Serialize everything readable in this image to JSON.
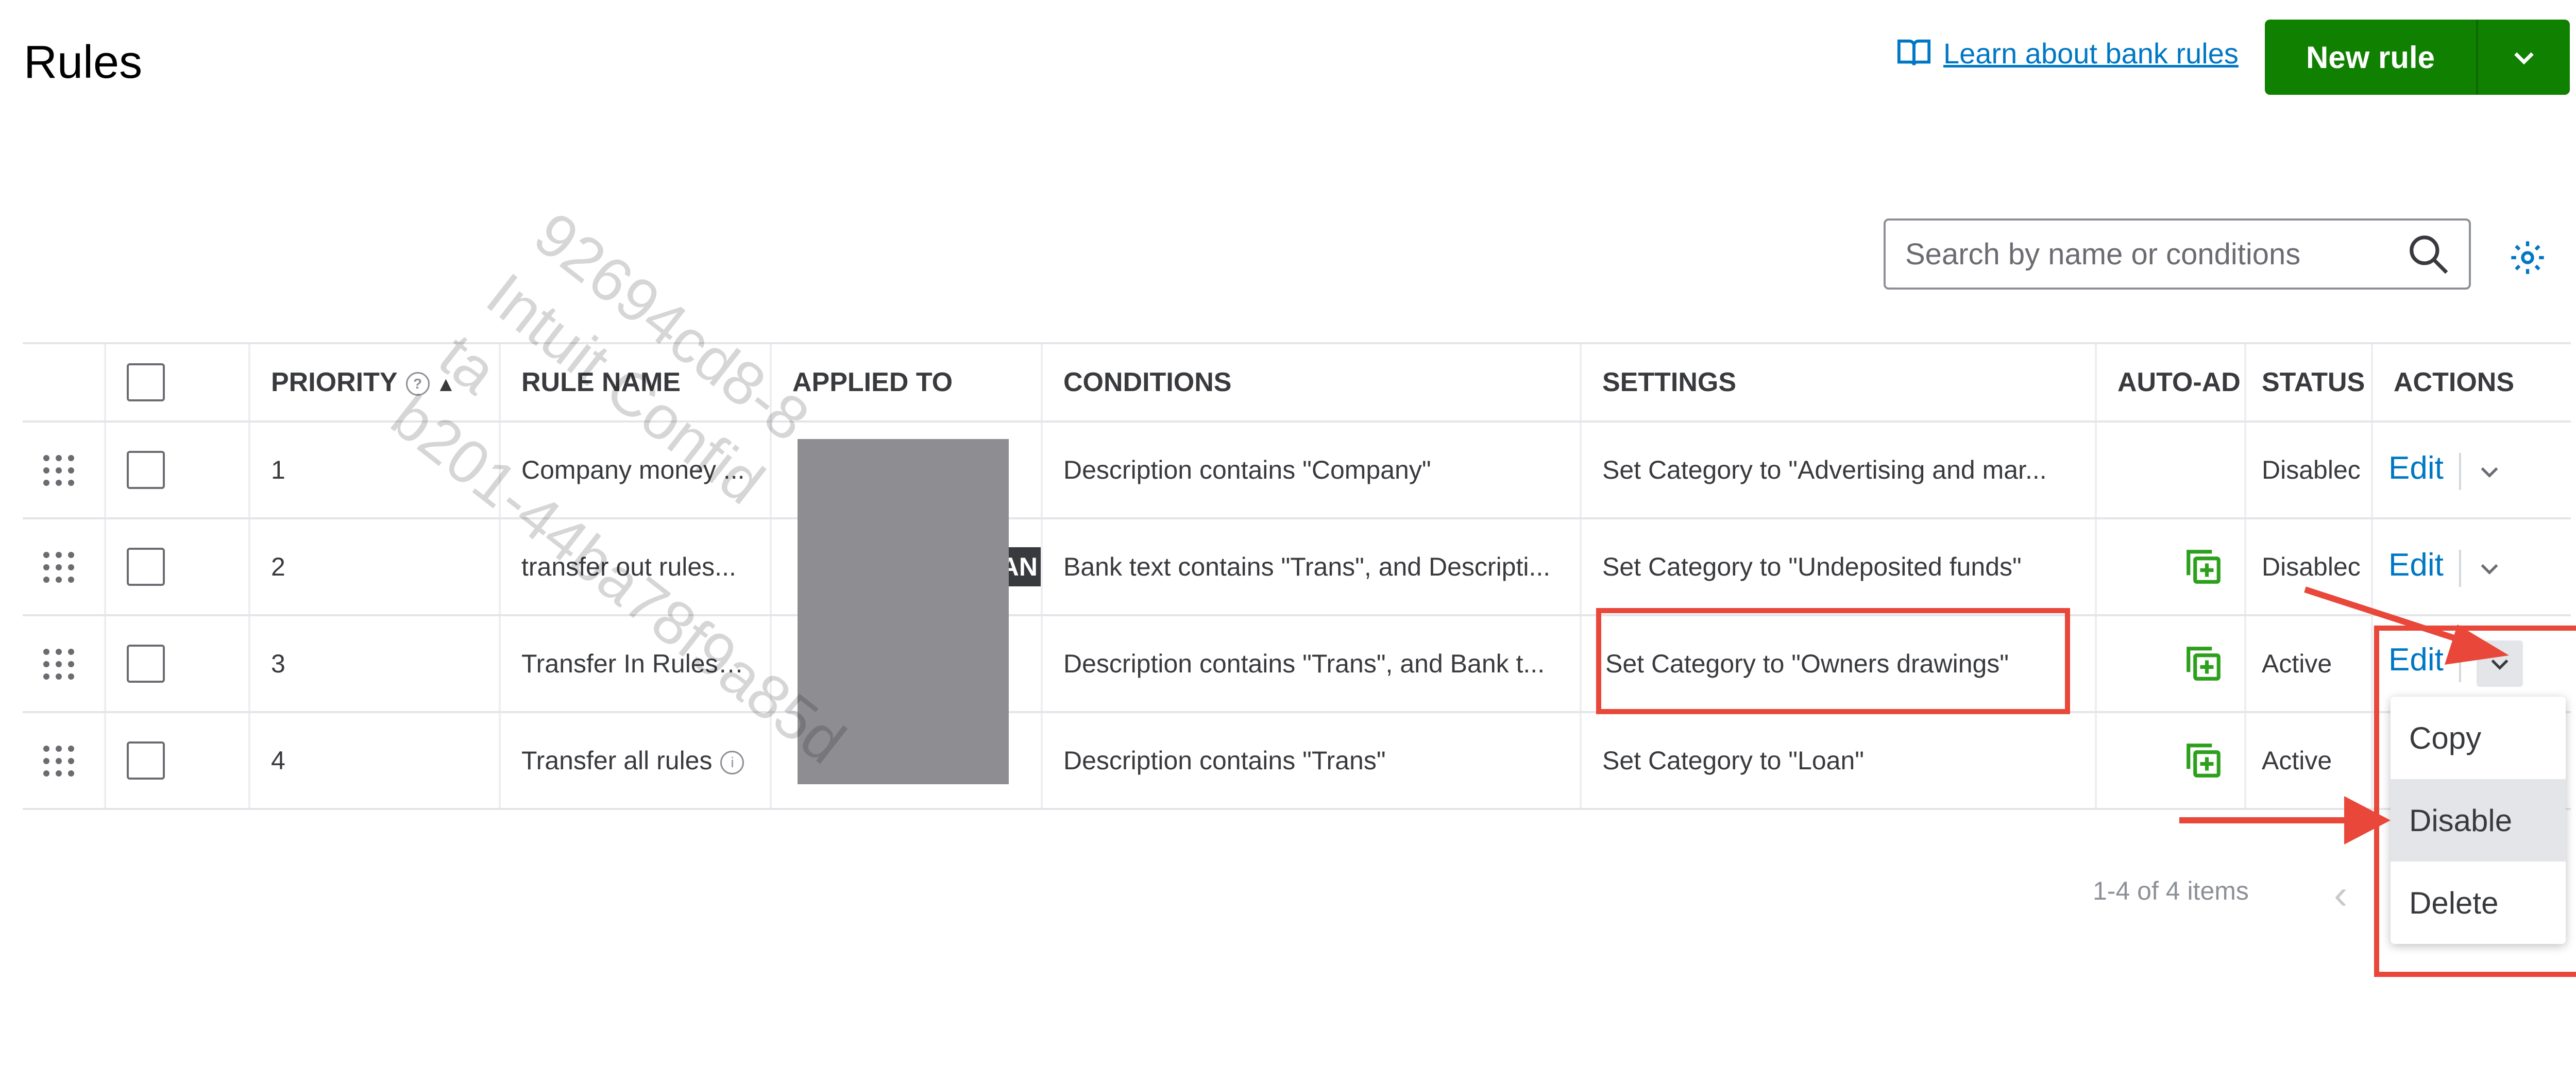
{
  "page": {
    "title": "Rules"
  },
  "header": {
    "learn_link": "Learn about bank rules",
    "new_rule": "New rule",
    "book_icon": "book-open-icon",
    "caret_icon": "chevron-down-icon",
    "brand_color": "#108000",
    "link_color": "#0077c5"
  },
  "search": {
    "placeholder": "Search by name or conditions",
    "value": ""
  },
  "table": {
    "headers": [
      "PRIORITY",
      "RULE NAME",
      "APPLIED TO",
      "CONDITIONS",
      "SETTINGS",
      "AUTO-AD",
      "STATUS",
      "ACTIONS"
    ],
    "rows": [
      {
        "priority": "1",
        "rule_name": "Company money ...",
        "conditions": "Description contains \"Company\"",
        "settings": "Set Category to \"Advertising and mar...",
        "auto_add": false,
        "status": "Disablec",
        "edit": "Edit"
      },
      {
        "priority": "2",
        "rule_name": "transfer out rules...",
        "conditions": "Bank text contains \"Trans\", and Descripti...",
        "settings": "Set Category to \"Undeposited funds\"",
        "auto_add": true,
        "status": "Disablec",
        "edit": "Edit"
      },
      {
        "priority": "3",
        "rule_name": "Transfer In Rules",
        "conditions": "Description contains \"Trans\", and Bank t...",
        "settings": "Set Category to \"Owners drawings\"",
        "auto_add": true,
        "status": "Active",
        "edit": "Edit"
      },
      {
        "priority": "4",
        "rule_name": "Transfer all rules",
        "conditions": "Description contains \"Trans\"",
        "settings": "Set Category to \"Loan\"",
        "auto_add": true,
        "status": "Active",
        "edit": "Edit"
      }
    ],
    "applied_fragment": "AN"
  },
  "actions_menu": {
    "items": [
      "Copy",
      "Disable",
      "Delete"
    ],
    "highlighted": "Disable"
  },
  "pager": {
    "text": "1-4 of 4 items"
  },
  "annotation_color": "#e8473a",
  "watermark": {
    "line1": "92694cd8-8",
    "line2": "Intuit Confid",
    "line3": "ta",
    "line4": "b201-44ba78f9a85d"
  }
}
